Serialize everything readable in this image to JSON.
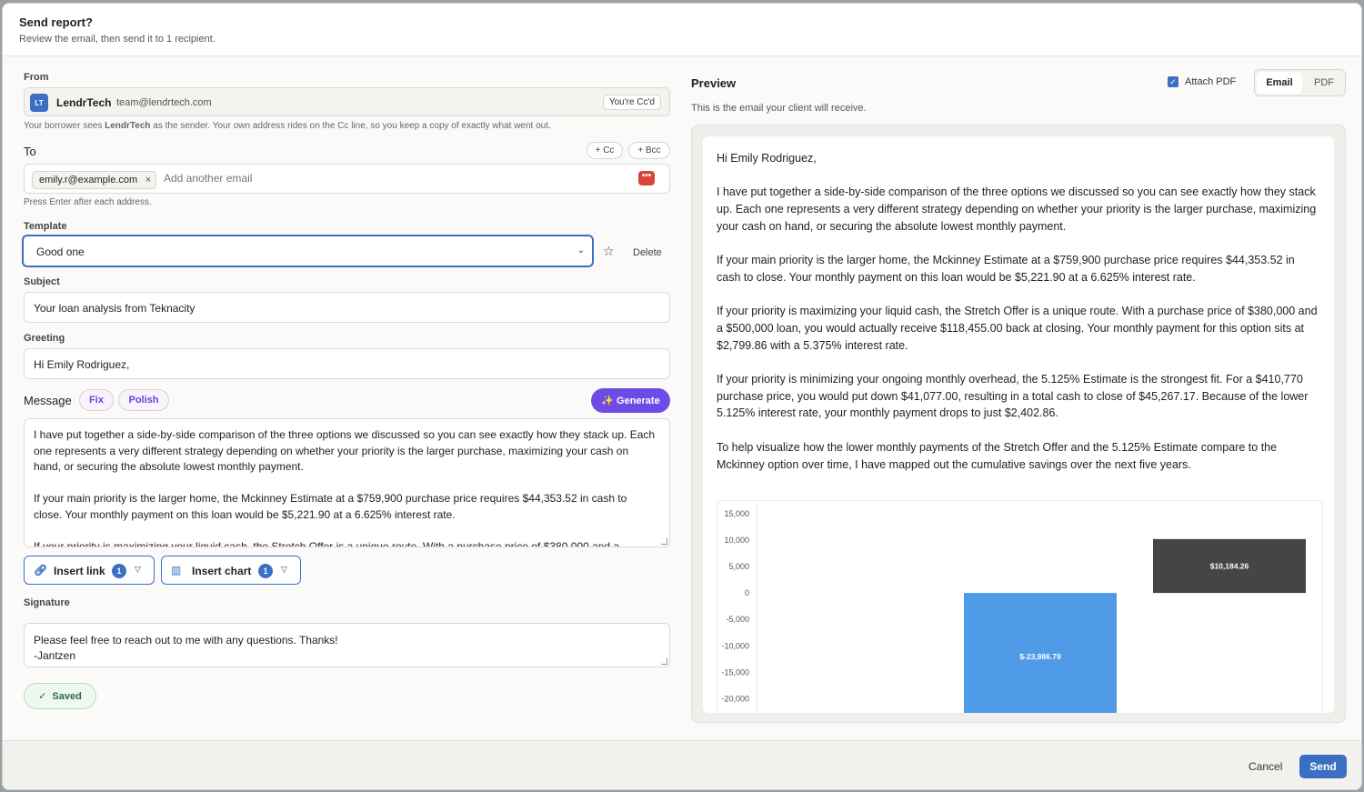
{
  "dialog": {
    "title": "Send report?",
    "subtitle": "Review the email, then send it to 1 recipient."
  },
  "from": {
    "label": "From",
    "avatar": "LT",
    "name": "LendrTech",
    "email": "team@lendrtech.com",
    "badge": "You're Cc'd",
    "hint_pre": "Your borrower sees ",
    "hint_bold": "LendrTech",
    "hint_post": " as the sender. Your own address rides on the Cc line, so you keep a copy of exactly what went out."
  },
  "to": {
    "label": "To",
    "cc_button": "+ Cc",
    "bcc_button": "+ Bcc",
    "chip": "emily.r@example.com",
    "chip_remove": "×",
    "placeholder": "Add another email",
    "hint": "Press Enter after each address.",
    "extension_icon": "dots-icon"
  },
  "template": {
    "label": "Template",
    "selected": "Good one",
    "delete_label": "Delete",
    "star_icon": "star-icon"
  },
  "subject": {
    "label": "Subject",
    "value": "Your loan analysis from Teknacity"
  },
  "greeting": {
    "label": "Greeting",
    "value": "Hi Emily Rodriguez,"
  },
  "message": {
    "label": "Message",
    "fix_label": "Fix",
    "polish_label": "Polish",
    "generate_label": "✨ Generate",
    "body": "I have put together a side-by-side comparison of the three options we discussed so you can see exactly how they stack up. Each one represents a very different strategy depending on whether your priority is the larger purchase, maximizing your cash on hand, or securing the absolute lowest monthly payment.\n\nIf your main priority is the larger home, the Mckinney Estimate at a $759,900 purchase price requires $44,353.52 in cash to close. Your monthly payment on this loan would be $5,221.90 at a 6.625% interest rate.\n\nIf your priority is maximizing your liquid cash, the Stretch Offer is a unique route. With a purchase price of $380,000 and a"
  },
  "insert": {
    "link_label": "Insert link",
    "link_count": "1",
    "chart_label": "Insert chart",
    "chart_count": "1"
  },
  "signature": {
    "label": "Signature",
    "value": "Please feel free to reach out to me with any questions. Thanks!\n-Jantzen"
  },
  "saved_label": "Saved",
  "preview": {
    "title": "Preview",
    "subtitle": "This is the email your client will receive.",
    "attach_label": "Attach PDF",
    "attach_checked": true,
    "tab_email": "Email",
    "tab_pdf": "PDF",
    "greeting": "Hi Emily Rodriguez,",
    "paragraphs": [
      "I have put together a side-by-side comparison of the three options we discussed so you can see exactly how they stack up. Each one represents a very different strategy depending on whether your priority is the larger purchase, maximizing your cash on hand, or securing the absolute lowest monthly payment.",
      "If your main priority is the larger home, the Mckinney Estimate at a $759,900 purchase price requires $44,353.52 in cash to close. Your monthly payment on this loan would be $5,221.90 at a 6.625% interest rate.",
      "If your priority is maximizing your liquid cash, the Stretch Offer is a unique route. With a purchase price of $380,000 and a $500,000 loan, you would actually receive $118,455.00 back at closing. Your monthly payment for this option sits at $2,799.86 with a 5.375% interest rate.",
      "If your priority is minimizing your ongoing monthly overhead, the 5.125% Estimate is the strongest fit. For a $410,770 purchase price, you would put down $41,077.00, resulting in a total cash to close of $45,267.17. Because of the lower 5.125% interest rate, your monthly payment drops to just $2,402.86.",
      "To help visualize how the lower monthly payments of the Stretch Offer and the 5.125% Estimate compare to the Mckinney option over time, I have mapped out the cumulative savings over the next five years."
    ]
  },
  "chart_data": {
    "type": "bar",
    "series": [
      {
        "values": [
          -23986.79,
          10184.26
        ],
        "colors": [
          "#4f9be8",
          "#454545"
        ],
        "labels": [
          "$-23,986.79",
          "$10,184.26"
        ]
      }
    ],
    "yticks": [
      "15,000",
      "10,000",
      "5,000",
      "0",
      "-5,000",
      "-10,000",
      "-15,000",
      "-20,000"
    ],
    "ylim": [
      -22500,
      16000
    ],
    "grid": false
  },
  "footer": {
    "cancel_label": "Cancel",
    "send_label": "Send"
  },
  "colors": {
    "accent": "#3b6fc4",
    "generate": "#6d4ce6",
    "danger": "#d9443a"
  }
}
